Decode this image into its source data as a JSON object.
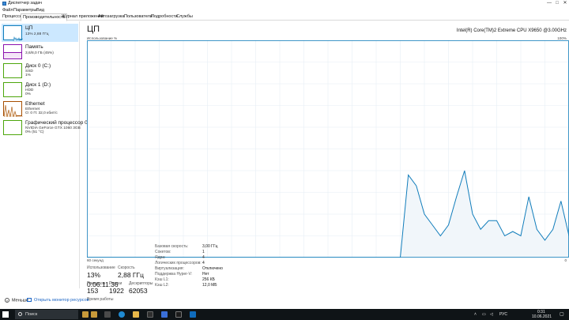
{
  "window": {
    "title": "Диспетчер задач",
    "controls": [
      "—",
      "□",
      "✕"
    ]
  },
  "menu": [
    "Файл",
    "Параметры",
    "Вид"
  ],
  "tabs": [
    {
      "label": "Процессы",
      "active": false
    },
    {
      "label": "Производительность",
      "active": true
    },
    {
      "label": "Журнал приложений",
      "active": false
    },
    {
      "label": "Автозагрузка",
      "active": false
    },
    {
      "label": "Пользователи",
      "active": false
    },
    {
      "label": "Подробности",
      "active": false
    },
    {
      "label": "Службы",
      "active": false
    }
  ],
  "sidebar": {
    "items": [
      {
        "name": "ЦП",
        "sub1": "13% 2,88 ГГц",
        "sub2": "",
        "color": "#117dbb",
        "icon": "cpu-thumb"
      },
      {
        "name": "Память",
        "sub1": "3,6/8,0 ГБ (45%)",
        "sub2": "",
        "color": "#8b12ae",
        "icon": "memory-thumb",
        "fill_pct": 45
      },
      {
        "name": "Диск 0 (C:)",
        "sub1": "SSD",
        "sub2": "1%",
        "color": "#4da60c",
        "icon": "disk-thumb"
      },
      {
        "name": "Диск 1 (D:)",
        "sub1": "HDD",
        "sub2": "0%",
        "color": "#4da60c",
        "icon": "disk-thumb"
      },
      {
        "name": "Ethernet",
        "sub1": "Ethernet",
        "sub2": "О: 0 П: 32,0 кбит/с",
        "color": "#a74f01",
        "icon": "ethernet-thumb"
      },
      {
        "name": "Графический процессор 0",
        "sub1": "NVIDIA GeForce GTX 1060 3GB",
        "sub2": "0% (51 °C)",
        "color": "#4da60c",
        "icon": "gpu-thumb"
      }
    ]
  },
  "cpu": {
    "title": "ЦП",
    "model": "Intel(R) Core(TM)2 Extreme CPU X9650 @3.00GHz",
    "util_label": "Использование %",
    "pct_label": "100%",
    "axis_left": "60 секунд",
    "axis_right": "0",
    "graph_color": "#117dbb",
    "graph_fill": "#f1f6fa"
  },
  "chart_data": {
    "type": "area",
    "ylim": [
      0,
      100
    ],
    "xlim": [
      60,
      0
    ],
    "xlabel": "60 секунд",
    "ylabel": "Использование %",
    "grid": true,
    "series": [
      {
        "x": [
          60,
          59,
          58,
          57,
          56,
          55,
          54,
          53,
          52,
          51,
          50,
          49,
          48,
          47,
          46,
          45,
          44,
          43,
          42,
          41,
          40,
          39,
          38,
          37,
          36,
          35,
          34,
          33,
          32,
          31,
          30,
          29,
          28,
          27,
          26,
          25,
          24,
          23,
          22,
          21,
          20,
          19,
          18,
          17,
          16,
          15,
          14,
          13,
          12,
          11,
          10,
          9,
          8,
          7,
          6,
          5,
          4,
          3,
          2,
          1,
          0
        ],
        "values": [
          0,
          0,
          0,
          0,
          0,
          0,
          0,
          0,
          0,
          0,
          0,
          0,
          0,
          0,
          0,
          0,
          0,
          0,
          0,
          0,
          0,
          0,
          0,
          0,
          0,
          0,
          0,
          0,
          0,
          0,
          0,
          0,
          0,
          0,
          0,
          0,
          0,
          0,
          0,
          0,
          38,
          33,
          20,
          15,
          10,
          15,
          28,
          40,
          20,
          13,
          17,
          17,
          10,
          12,
          10,
          28,
          13,
          8,
          13,
          26,
          10
        ]
      }
    ]
  },
  "stats": {
    "util_label": "Использование",
    "util_value": "13%",
    "speed_label": "Скорость",
    "speed_value": "2,88 ГГц",
    "proc_label": "Процессы",
    "proc_value": "153",
    "threads_label": "Потоки",
    "threads_value": "1922",
    "handles_label": "Дескрипторы",
    "handles_value": "62053",
    "uptime_label": "Время работы",
    "uptime_value": "0:06:11:36"
  },
  "info": [
    {
      "label": "Базовая скорость:",
      "value": "3,00 ГГц"
    },
    {
      "label": "Сокетов:",
      "value": "1"
    },
    {
      "label": "Ядра:",
      "value": "4"
    },
    {
      "label": "Логических процессоров:",
      "value": "4"
    },
    {
      "label": "Виртуализация:",
      "value": "Отключено"
    },
    {
      "label": "Поддержка Hyper-V:",
      "value": "Нет"
    },
    {
      "label": "Кэш L1:",
      "value": "256 КБ"
    },
    {
      "label": "Кэш L2:",
      "value": "12,0 МБ"
    }
  ],
  "footer": {
    "less_label": "Меньше",
    "monitor_label": "Открыть монитор ресурсов"
  },
  "taskbar": {
    "search_label": "Поиск",
    "lang": "РУС",
    "time": "0:31",
    "date": "10.06.2021"
  }
}
